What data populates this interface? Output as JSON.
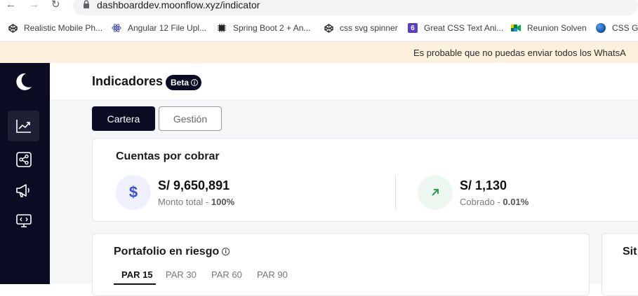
{
  "browser": {
    "url": "dashboarddev.moonflow.xyz/indicator",
    "bookmarks": [
      {
        "label": "Realistic Mobile Ph...",
        "icon": "codepen-icon"
      },
      {
        "label": "Angular 12 File Upl...",
        "icon": "react-atom-icon"
      },
      {
        "label": "Spring Boot 2 + An...",
        "icon": "chip-icon"
      },
      {
        "label": "css svg spinner",
        "icon": "codepen-icon"
      },
      {
        "label": "Great CSS Text Ani...",
        "icon": "six-icon"
      },
      {
        "label": "Reunion Solven",
        "icon": "meet-icon"
      },
      {
        "label": "CSS Gr",
        "icon": "globe-icon"
      }
    ]
  },
  "banner": {
    "text": "Es probable que no puedas enviar todos los WhatsA"
  },
  "sidebar": {
    "items": [
      {
        "icon": "trend-chart-icon",
        "active": true
      },
      {
        "icon": "share-nodes-icon",
        "active": false
      },
      {
        "icon": "megaphone-icon",
        "active": false
      },
      {
        "icon": "monitor-code-icon",
        "active": false
      }
    ]
  },
  "header": {
    "title": "Indicadores",
    "badge": "Beta",
    "info": "i"
  },
  "tabs": {
    "cartera": "Cartera",
    "gestion": "Gestión"
  },
  "cuentas": {
    "title": "Cuentas por cobrar",
    "monto": {
      "value": "S/ 9,650,891",
      "label": "Monto total - ",
      "pct": "100%"
    },
    "cobrado": {
      "value": "S/ 1,130",
      "label": "Cobrado - ",
      "pct": "0.01%"
    }
  },
  "portafolio": {
    "title": "Portafolio en riesgo",
    "info": "i",
    "tabs": [
      "PAR 15",
      "PAR 30",
      "PAR 60",
      "PAR 90"
    ]
  },
  "situacion": {
    "title": "Sit"
  },
  "colors": {
    "sidebar": "#0b0b24",
    "banner": "#fcf1dc",
    "money_bg": "#eef0fb",
    "money_fg": "#3b4fd6",
    "up_bg": "#ecf7ef",
    "up_fg": "#2e9e4d"
  }
}
